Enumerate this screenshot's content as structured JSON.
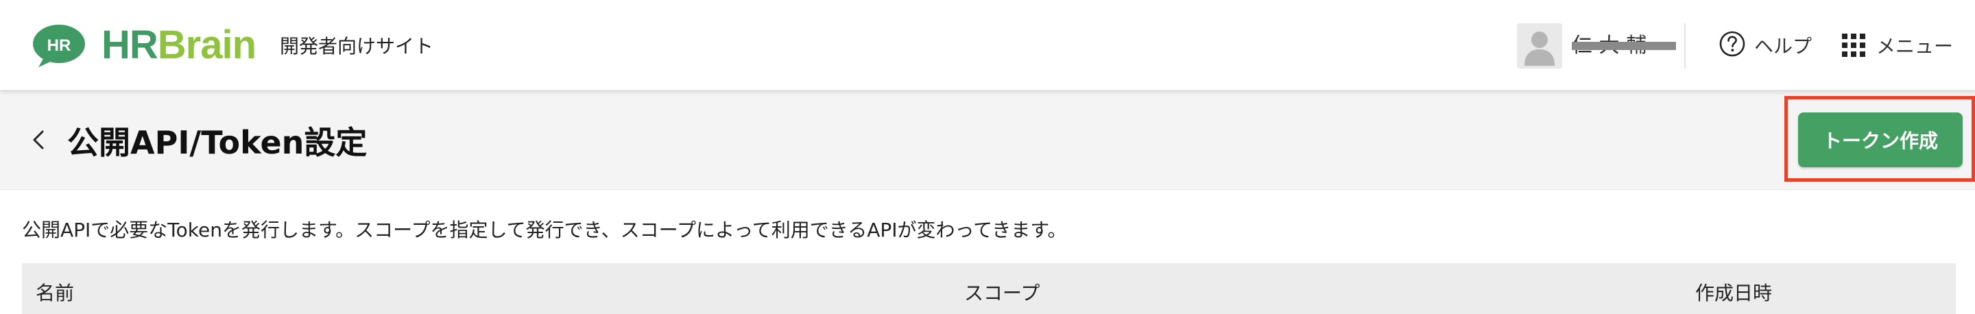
{
  "header": {
    "logo": {
      "badge": "HR",
      "word_hr": "HR",
      "word_brain": "Brain"
    },
    "site_label": "開発者向けサイト",
    "user": {
      "name": "仁 大 輔"
    },
    "help_label": "ヘルプ",
    "menu_label": "メニュー"
  },
  "page": {
    "title": "公開API/Token設定",
    "create_button_label": "トークン作成",
    "description": "公開APIで必要なTokenを発行します。スコープを指定して発行でき、スコープによって利用できるAPIが変わってきます。"
  },
  "table": {
    "columns": [
      "名前",
      "スコープ",
      "作成日時"
    ]
  },
  "colors": {
    "brand_green": "#3f9a63",
    "brand_lime": "#8fc33f",
    "button_green": "#45a064",
    "highlight_red": "#e8432a"
  },
  "icons": {
    "help": "question-circle-icon",
    "menu": "grid-icon",
    "back": "chevron-left-icon",
    "avatar": "user-silhouette-icon"
  }
}
